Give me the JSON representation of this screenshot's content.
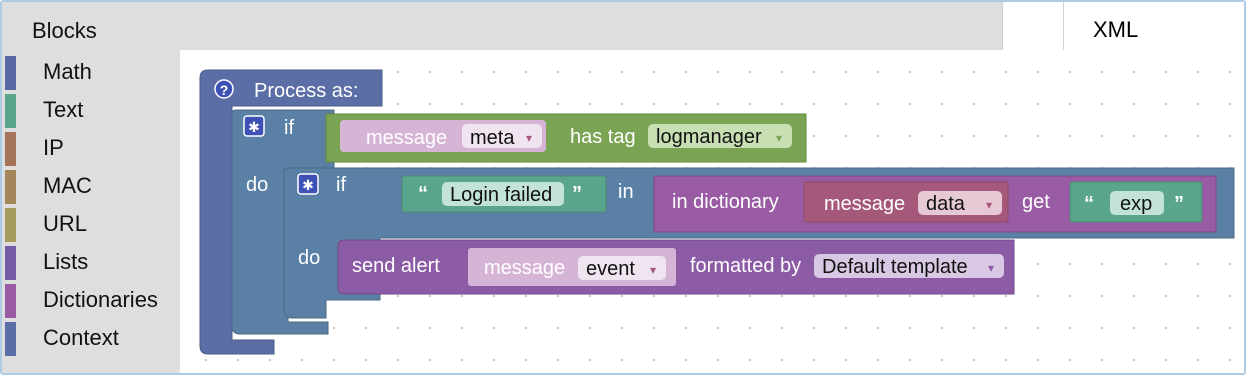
{
  "tabs": {
    "blocks": "Blocks",
    "xml": "XML"
  },
  "toolbox": [
    {
      "label": "Math",
      "color": "#5b67a5"
    },
    {
      "label": "Text",
      "color": "#5ba58c"
    },
    {
      "label": "IP",
      "color": "#a5745b"
    },
    {
      "label": "MAC",
      "color": "#a5865b"
    },
    {
      "label": "URL",
      "color": "#a59c5b"
    },
    {
      "label": "Lists",
      "color": "#745ba5"
    },
    {
      "label": "Dictionaries",
      "color": "#9a5ba5"
    },
    {
      "label": "Context",
      "color": "#5b6ea5"
    }
  ],
  "blocks": {
    "process_as": "Process as:",
    "if": "if",
    "do": "do",
    "message": "message",
    "meta": "meta",
    "has_tag": "has tag",
    "logmanager": "logmanager",
    "login_failed": "Login failed",
    "in": "in",
    "in_dictionary": "in dictionary",
    "data": "data",
    "get": "get",
    "exp": "exp",
    "send_alert": "send alert",
    "event": "event",
    "formatted_by": "formatted by",
    "default_template": "Default template",
    "help_glyph": "?",
    "quote_open": "“",
    "quote_close": "”",
    "dropdown_glyph": "▾",
    "gear_icon": "gear-icon",
    "help_icon": "help-icon"
  },
  "colors": {
    "process": "#5b6ea5",
    "if_outer": "#5b80a5",
    "if_inner": "#5b80a5",
    "logic_green": "#7aa454",
    "text_green": "#5ba58c",
    "message_pink": "#d6b4d6",
    "dictionary_purple": "#9a5ba5",
    "message_red": "#a5587a",
    "send_purple": "#8b5ba5"
  }
}
